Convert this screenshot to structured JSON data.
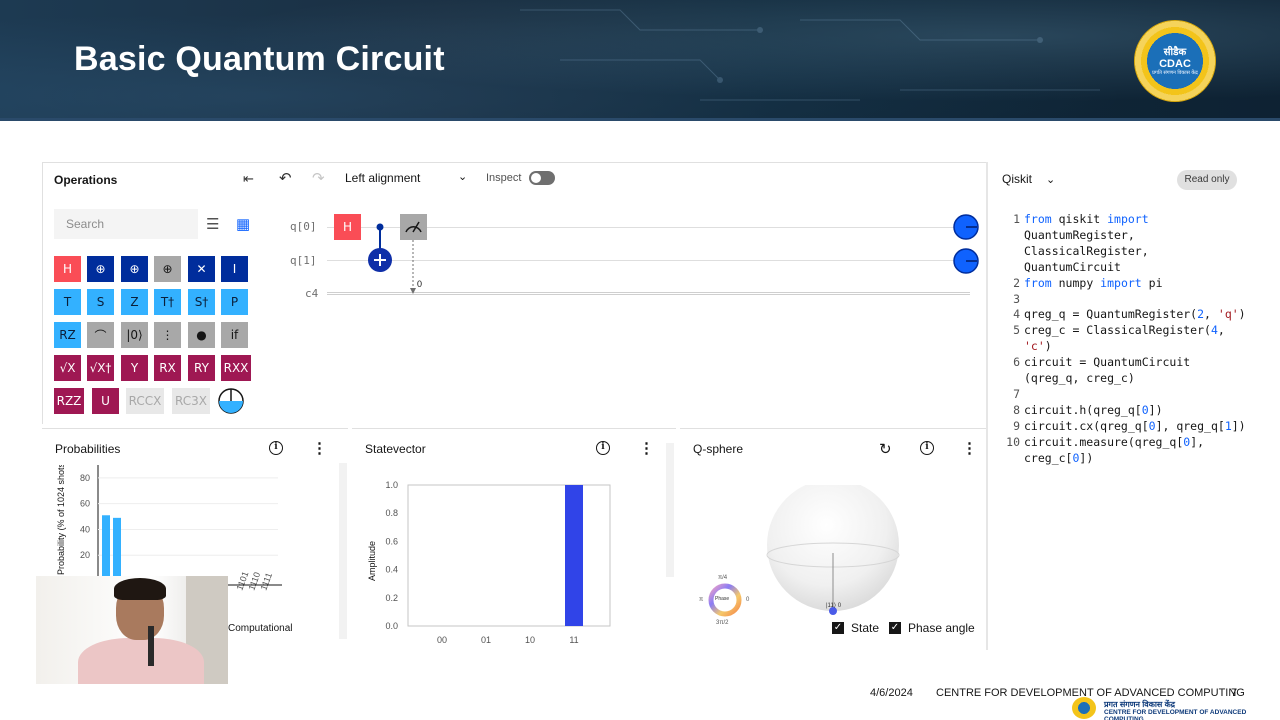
{
  "slide": {
    "title": "Basic Quantum Circuit",
    "logo_hindi": "सीडैक",
    "logo_text": "CDAC",
    "logo_motto": "प्रगति संगणन विकास केंद्र"
  },
  "operations": {
    "title": "Operations",
    "search_placeholder": "Search",
    "gates": [
      {
        "label": "H",
        "color": "#fa4d56"
      },
      {
        "label": "⊕",
        "color": "#002d9c"
      },
      {
        "label": "⊕",
        "color": "#002d9c"
      },
      {
        "label": "⊕",
        "color": "#a8a8a8"
      },
      {
        "label": "✕",
        "color": "#002d9c"
      },
      {
        "label": "I",
        "color": "#002d9c"
      },
      {
        "label": "T",
        "color": "#33b1ff"
      },
      {
        "label": "S",
        "color": "#33b1ff"
      },
      {
        "label": "Z",
        "color": "#33b1ff"
      },
      {
        "label": "T†",
        "color": "#33b1ff"
      },
      {
        "label": "S†",
        "color": "#33b1ff"
      },
      {
        "label": "P",
        "color": "#33b1ff"
      },
      {
        "label": "RZ",
        "color": "#33b1ff"
      },
      {
        "label": "⌒",
        "color": "#a8a8a8"
      },
      {
        "label": "|0⟩",
        "color": "#a8a8a8"
      },
      {
        "label": "⋮",
        "color": "#a8a8a8"
      },
      {
        "label": "●",
        "color": "#a8a8a8"
      },
      {
        "label": "if",
        "color": "#a8a8a8"
      },
      {
        "label": "√X",
        "color": "#9f1853"
      },
      {
        "label": "√X†",
        "color": "#9f1853"
      },
      {
        "label": "Y",
        "color": "#9f1853"
      },
      {
        "label": "RX",
        "color": "#9f1853"
      },
      {
        "label": "RY",
        "color": "#9f1853"
      },
      {
        "label": "RXX",
        "color": "#9f1853"
      },
      {
        "label": "RZZ",
        "color": "#9f1853"
      },
      {
        "label": "U",
        "color": "#9f1853"
      },
      {
        "label": "RCCX",
        "color": "#e8e8e8"
      },
      {
        "label": "RC3X",
        "color": "#e8e8e8"
      }
    ]
  },
  "toolbar": {
    "alignment": "Left alignment",
    "inspect_label": "Inspect"
  },
  "circuit": {
    "wires": [
      "q[0]",
      "q[1]",
      "c4"
    ],
    "h_gate": "H",
    "measure_bit": "0"
  },
  "panels": {
    "probabilities": {
      "title": "Probabilities",
      "ylabel": "Probability (% of 1024 shots)",
      "xlabel": "Computational basis states",
      "yticks": [
        "80",
        "60",
        "40",
        "20"
      ],
      "xticks": [
        "1101",
        "1110",
        "1111"
      ],
      "values": [
        51,
        49
      ]
    },
    "statevector": {
      "title": "Statevector",
      "ylabel": "Amplitude",
      "yticks": [
        "1.0",
        "0.8",
        "0.6",
        "0.4",
        "0.2",
        "0.0"
      ],
      "xticks": [
        "00",
        "01",
        "10",
        "11"
      ],
      "values": [
        0,
        0,
        0,
        1.0
      ],
      "bar_color": "#3044e8"
    },
    "qsphere": {
      "title": "Q-sphere",
      "state_label": "State",
      "phase_label": "Phase angle",
      "phase_text": "Phase",
      "phase_top": "π/4",
      "phase_bottom": "3π/2",
      "phase_left": "π",
      "phase_right": "0",
      "ket": "|11⟩ 0"
    }
  },
  "code": {
    "language": "Qiskit",
    "badge": "Read only"
  },
  "footer": {
    "date": "4/6/2024",
    "org": "CENTRE FOR DEVELOPMENT OF ADVANCED COMPUTING",
    "page": "7",
    "logo_hindi": "प्रगत संगणन विकास केंद्र",
    "logo_eng": "CENTRE FOR DEVELOPMENT OF ADVANCED COMPUTING"
  }
}
